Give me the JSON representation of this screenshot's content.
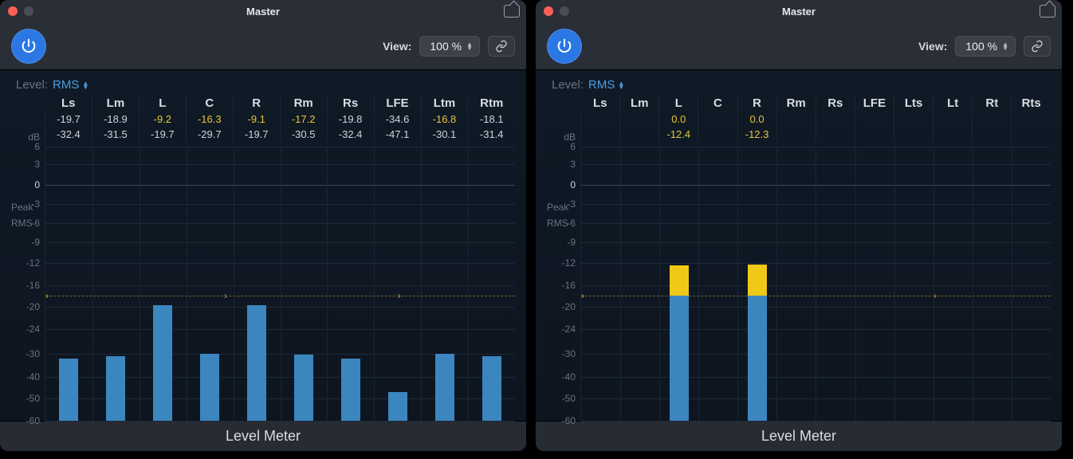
{
  "windows": [
    {
      "title": "Master",
      "view_label": "View:",
      "view_value": "100 %",
      "level_label": "Level:",
      "level_value": "RMS",
      "footer": "Level Meter",
      "axis": {
        "label": "dB",
        "ticks": [
          6,
          3,
          0,
          -3,
          -6,
          -9,
          -12,
          -16,
          -20,
          -24,
          -30,
          -40,
          -50,
          -60
        ],
        "min": -60,
        "max": 6,
        "baseline": -18
      },
      "channels": [
        {
          "name": "Ls",
          "peak": "-19.7",
          "rms": "-32.4",
          "peak_hl": false,
          "bar": {
            "top": -32,
            "tip": 0
          }
        },
        {
          "name": "Lm",
          "peak": "-18.9",
          "rms": "-31.5",
          "peak_hl": false,
          "bar": {
            "top": -31,
            "tip": 0
          }
        },
        {
          "name": "L",
          "peak": "-9.2",
          "rms": "-19.7",
          "peak_hl": true,
          "bar": {
            "top": -19.7,
            "tip": 0
          }
        },
        {
          "name": "C",
          "peak": "-16.3",
          "rms": "-29.7",
          "peak_hl": true,
          "bar": {
            "top": -30,
            "tip": 0
          }
        },
        {
          "name": "R",
          "peak": "-9.1",
          "rms": "-19.7",
          "peak_hl": true,
          "bar": {
            "top": -19.7,
            "tip": 0
          }
        },
        {
          "name": "Rm",
          "peak": "-17.2",
          "rms": "-30.5",
          "peak_hl": true,
          "bar": {
            "top": -30.5,
            "tip": 0
          }
        },
        {
          "name": "Rs",
          "peak": "-19.8",
          "rms": "-32.4",
          "peak_hl": false,
          "bar": {
            "top": -32,
            "tip": 0
          }
        },
        {
          "name": "LFE",
          "peak": "-34.6",
          "rms": "-47.1",
          "peak_hl": false,
          "bar": {
            "top": -47,
            "tip": 0
          }
        },
        {
          "name": "Ltm",
          "peak": "-16.8",
          "rms": "-30.1",
          "peak_hl": true,
          "bar": {
            "top": -30,
            "tip": 0
          }
        },
        {
          "name": "Rtm",
          "peak": "-18.1",
          "rms": "-31.4",
          "peak_hl": false,
          "bar": {
            "top": -31,
            "tip": 0
          }
        }
      ],
      "row_labels": {
        "peak": "Peak",
        "rms": "RMS"
      }
    },
    {
      "title": "Master",
      "view_label": "View:",
      "view_value": "100 %",
      "level_label": "Level:",
      "level_value": "RMS",
      "footer": "Level Meter",
      "axis": {
        "label": "dB",
        "ticks": [
          6,
          3,
          0,
          -3,
          -6,
          -9,
          -12,
          -16,
          -20,
          -24,
          -30,
          -40,
          -50,
          -60
        ],
        "min": -60,
        "max": 6,
        "baseline": -18
      },
      "channels": [
        {
          "name": "Ls",
          "peak": "",
          "rms": "",
          "peak_hl": false,
          "bar": null
        },
        {
          "name": "Lm",
          "peak": "",
          "rms": "",
          "peak_hl": false,
          "bar": null
        },
        {
          "name": "L",
          "peak": "0.0",
          "rms": "-12.4",
          "peak_hl": true,
          "rms_hl": true,
          "bar": {
            "top": -12.4,
            "tip": -18
          }
        },
        {
          "name": "C",
          "peak": "",
          "rms": "",
          "peak_hl": false,
          "bar": null
        },
        {
          "name": "R",
          "peak": "0.0",
          "rms": "-12.3",
          "peak_hl": true,
          "rms_hl": true,
          "bar": {
            "top": -12.3,
            "tip": -18
          }
        },
        {
          "name": "Rm",
          "peak": "",
          "rms": "",
          "peak_hl": false,
          "bar": null
        },
        {
          "name": "Rs",
          "peak": "",
          "rms": "",
          "peak_hl": false,
          "bar": null
        },
        {
          "name": "LFE",
          "peak": "",
          "rms": "",
          "peak_hl": false,
          "bar": null
        },
        {
          "name": "Lts",
          "peak": "",
          "rms": "",
          "peak_hl": false,
          "bar": null
        },
        {
          "name": "Lt",
          "peak": "",
          "rms": "",
          "peak_hl": false,
          "bar": null
        },
        {
          "name": "Rt",
          "peak": "",
          "rms": "",
          "peak_hl": false,
          "bar": null
        },
        {
          "name": "Rts",
          "peak": "",
          "rms": "",
          "peak_hl": false,
          "bar": null
        }
      ],
      "row_labels": {
        "peak": "Peak",
        "rms": "RMS"
      }
    }
  ],
  "chart_data": [
    {
      "type": "bar",
      "title": "Level Meter",
      "categories": [
        "Ls",
        "Lm",
        "L",
        "C",
        "R",
        "Rm",
        "Rs",
        "LFE",
        "Ltm",
        "Rtm"
      ],
      "series": [
        {
          "name": "Peak",
          "values": [
            -19.7,
            -18.9,
            -9.2,
            -16.3,
            -9.1,
            -17.2,
            -19.8,
            -34.6,
            -16.8,
            -18.1
          ]
        },
        {
          "name": "RMS",
          "values": [
            -32.4,
            -31.5,
            -19.7,
            -29.7,
            -19.7,
            -30.5,
            -32.4,
            -47.1,
            -30.1,
            -31.4
          ]
        }
      ],
      "ylabel": "dB",
      "ylim": [
        -60,
        6
      ]
    },
    {
      "type": "bar",
      "title": "Level Meter",
      "categories": [
        "Ls",
        "Lm",
        "L",
        "C",
        "R",
        "Rm",
        "Rs",
        "LFE",
        "Lts",
        "Lt",
        "Rt",
        "Rts"
      ],
      "series": [
        {
          "name": "Peak",
          "values": [
            null,
            null,
            0.0,
            null,
            0.0,
            null,
            null,
            null,
            null,
            null,
            null,
            null
          ]
        },
        {
          "name": "RMS",
          "values": [
            null,
            null,
            -12.4,
            null,
            -12.3,
            null,
            null,
            null,
            null,
            null,
            null,
            null
          ]
        }
      ],
      "ylabel": "dB",
      "ylim": [
        -60,
        6
      ]
    }
  ]
}
